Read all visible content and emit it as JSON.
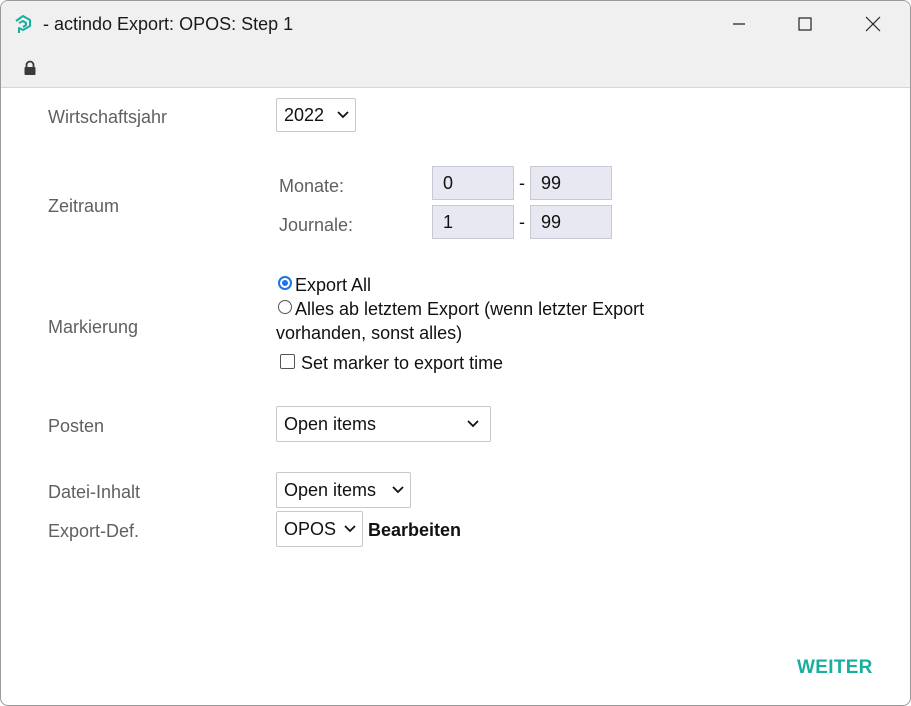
{
  "window": {
    "title": "- actindo Export: OPOS: Step 1",
    "accent_color": "#1aae9f"
  },
  "titlebar": {
    "controls": [
      "minimize-icon",
      "maximize-icon",
      "close-icon"
    ]
  },
  "addressbar": {
    "icon": "lock-icon"
  },
  "form": {
    "fiscal_year": {
      "label": "Wirtschaftsjahr",
      "value": "2022"
    },
    "period": {
      "label": "Zeitraum",
      "months": {
        "label": "Monate:",
        "from": "0",
        "to": "99",
        "separator": "-"
      },
      "journals": {
        "label": "Journale:",
        "from": "1",
        "to": "99",
        "separator": "-"
      }
    },
    "marking": {
      "label": "Markierung",
      "options": [
        {
          "text": "Export All",
          "checked": true
        },
        {
          "text_line1": "Alles ab letztem Export (wenn letzter Export",
          "text_line2": "vorhanden, sonst alles)",
          "checked": false
        }
      ],
      "checkbox": {
        "text": "Set marker to export time",
        "checked": false
      }
    },
    "items": {
      "label": "Posten",
      "value": "Open items"
    },
    "file_content": {
      "label": "Datei-Inhalt",
      "value": "Open items"
    },
    "export_def": {
      "label": "Export-Def.",
      "value": "OPOS",
      "edit_label": "Bearbeiten"
    }
  },
  "footer": {
    "next_label": "WEITER"
  }
}
